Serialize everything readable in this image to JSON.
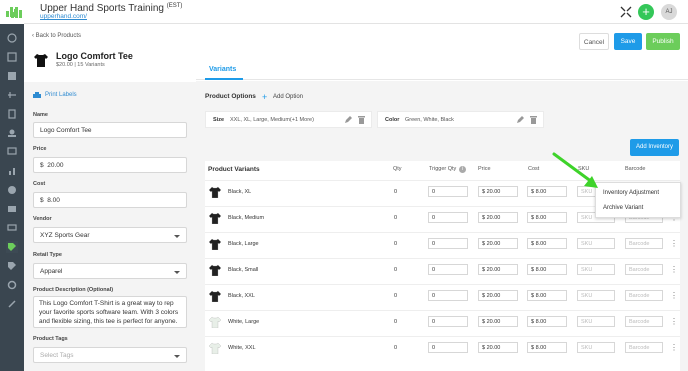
{
  "header": {
    "org_name": "Upper Hand Sports Training",
    "org_suffix": "(EST)",
    "org_link": "upperhand.com/",
    "avatar_initials": "AJ",
    "add_symbol": "+"
  },
  "page": {
    "back_label": "Back to Products",
    "product_name": "Logo Comfort Tee",
    "product_sub": "$20.00 | 15 Variants",
    "cancel_label": "Cancel",
    "save_label": "Save",
    "publish_label": "Publish"
  },
  "form": {
    "print_labels": "Print Labels",
    "name_label": "Name",
    "name_value": "Logo Comfort Tee",
    "price_label": "Price",
    "price_value": "20.00",
    "cost_label": "Cost",
    "cost_value": "8.00",
    "currency": "$",
    "vendor_label": "Vendor",
    "vendor_value": "XYZ Sports Gear",
    "retail_label": "Retail Type",
    "retail_value": "Apparel",
    "desc_label": "Product Description (Optional)",
    "desc_value": "This Logo Comfort T-Shirt is a great way to rep your favorite sports software team. With 3 colors and flexible sizing, this tee is perfect for anyone.",
    "tags_label": "Product Tags",
    "tags_placeholder": "Select Tags"
  },
  "tabs": {
    "variants": "Variants"
  },
  "options": {
    "title": "Product Options",
    "add_option": "Add Option",
    "size_label": "Size",
    "size_values": "XXL, XL, Large, Medium(+1 More)",
    "color_label": "Color",
    "color_values": "Green, White, Black"
  },
  "inventory": {
    "add_inventory": "Add Inventory"
  },
  "table": {
    "headers": {
      "variants": "Product Variants",
      "qty": "Qty",
      "trigger": "Trigger Qty",
      "price": "Price",
      "cost": "Cost",
      "sku": "SKU",
      "barcode": "Barcode"
    },
    "sku_placeholder": "SKU",
    "barcode_placeholder": "Barcode",
    "rows": [
      {
        "name": "Black, XL",
        "qty": "0",
        "trigger": "0",
        "price": "20.00",
        "cost": "8.00",
        "color": "#222"
      },
      {
        "name": "Black, Medium",
        "qty": "0",
        "trigger": "0",
        "price": "20.00",
        "cost": "8.00",
        "color": "#222"
      },
      {
        "name": "Black, Large",
        "qty": "0",
        "trigger": "0",
        "price": "20.00",
        "cost": "8.00",
        "color": "#222"
      },
      {
        "name": "Black, Small",
        "qty": "0",
        "trigger": "0",
        "price": "20.00",
        "cost": "8.00",
        "color": "#222"
      },
      {
        "name": "Black, XXL",
        "qty": "0",
        "trigger": "0",
        "price": "20.00",
        "cost": "8.00",
        "color": "#222"
      },
      {
        "name": "White, Large",
        "qty": "0",
        "trigger": "0",
        "price": "20.00",
        "cost": "8.00",
        "color": "#e8efe8"
      },
      {
        "name": "White, XXL",
        "qty": "0",
        "trigger": "0",
        "price": "20.00",
        "cost": "8.00",
        "color": "#e8efe8"
      }
    ]
  },
  "menu": {
    "inventory_adjustment": "Inventory Adjustment",
    "archive_variant": "Archive Variant"
  },
  "colors": {
    "accent": "#1e9be8",
    "publish": "#6ccd5b",
    "add": "#34c759",
    "sidebar": "#3a4650",
    "arrow": "#3ed32a"
  }
}
